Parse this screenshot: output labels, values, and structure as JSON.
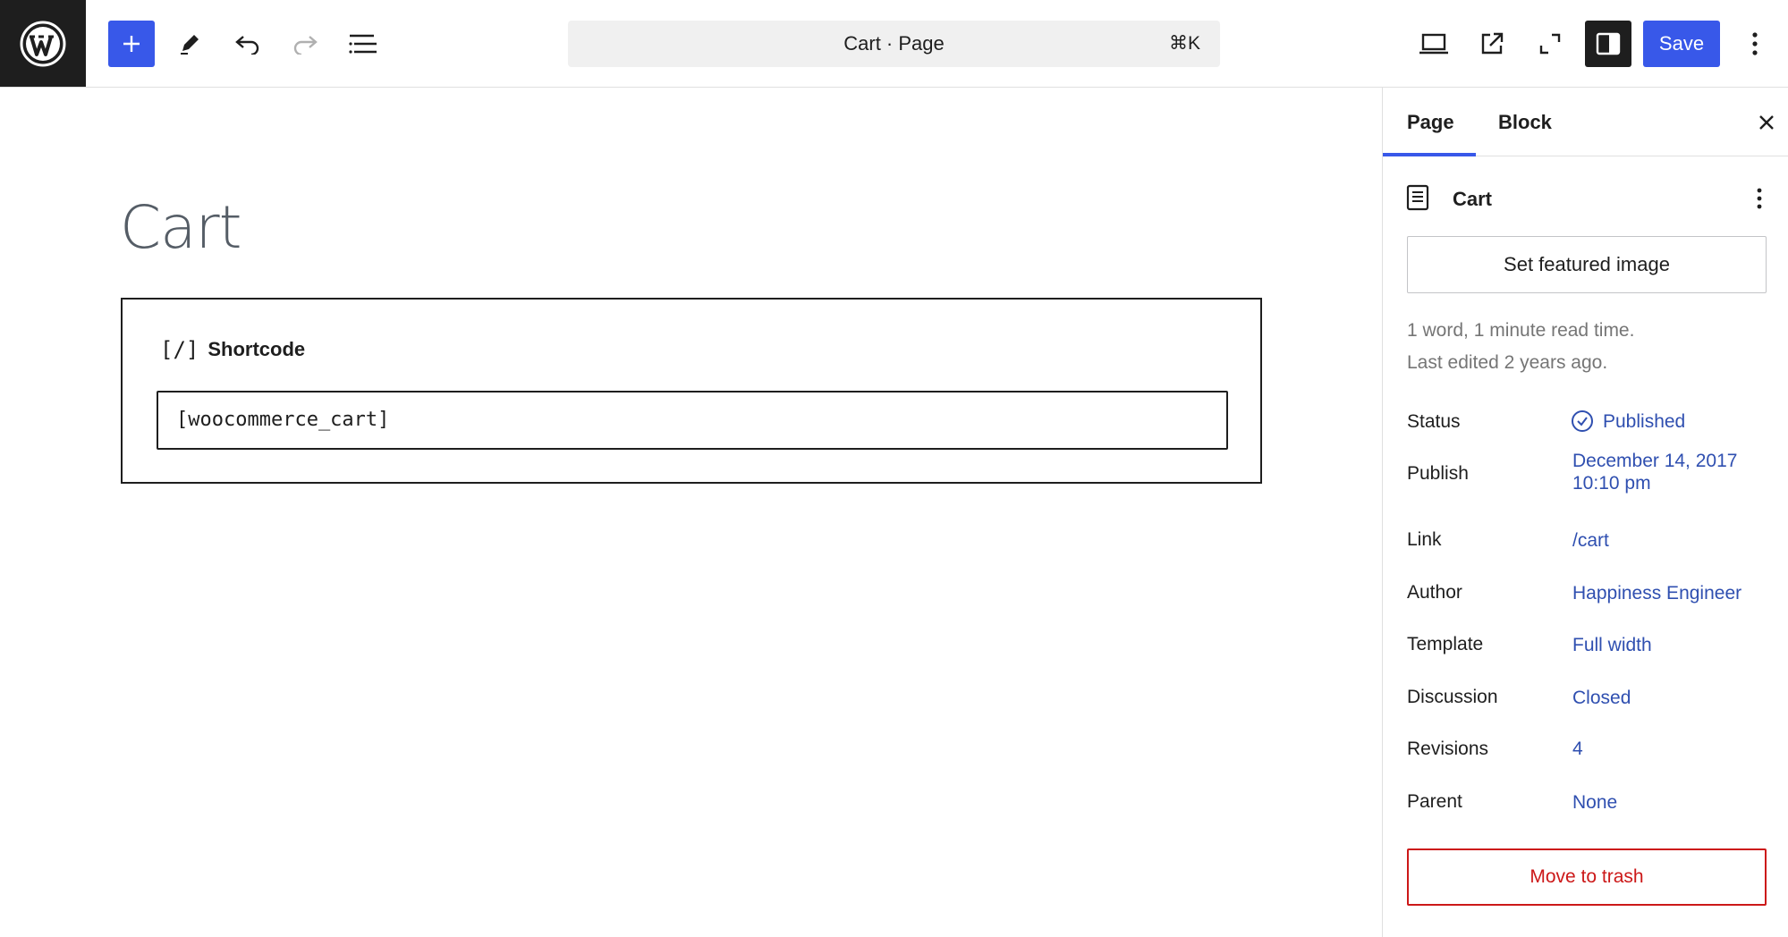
{
  "header": {
    "document_title": "Cart · Page",
    "shortcut": "⌘K",
    "save_label": "Save",
    "icons": [
      "wordpress-logo-icon",
      "plus-icon",
      "pen-icon",
      "undo-icon",
      "redo-icon",
      "list-view-icon",
      "laptop-icon",
      "external-link-icon",
      "fullscreen-icon",
      "sidebar-icon",
      "more-vertical-icon"
    ],
    "accent_color": "#3858e9"
  },
  "editor": {
    "page_title": "Cart",
    "block": {
      "label": "Shortcode",
      "icon": "[/]",
      "value": "[woocommerce_cart]"
    }
  },
  "sidebar": {
    "tabs": [
      {
        "label": "Page",
        "active": true
      },
      {
        "label": "Block",
        "active": false
      }
    ],
    "post_title": "Cart",
    "featured_image_label": "Set featured image",
    "meta_line_1": "1 word, 1 minute read time.",
    "meta_line_2": "Last edited 2 years ago.",
    "rows": {
      "status": {
        "label": "Status",
        "value": "Published"
      },
      "publish": {
        "label": "Publish",
        "value_line_1": "December 14, 2017",
        "value_line_2": "10:10 pm"
      },
      "link": {
        "label": "Link",
        "value": "/cart"
      },
      "author": {
        "label": "Author",
        "value": "Happiness Engineer"
      },
      "template": {
        "label": "Template",
        "value": "Full width"
      },
      "discussion": {
        "label": "Discussion",
        "value": "Closed"
      },
      "revisions": {
        "label": "Revisions",
        "value": "4"
      },
      "parent": {
        "label": "Parent",
        "value": "None"
      }
    },
    "trash_label": "Move to trash",
    "link_color": "#2f4fb0",
    "danger_color": "#cc1818"
  }
}
